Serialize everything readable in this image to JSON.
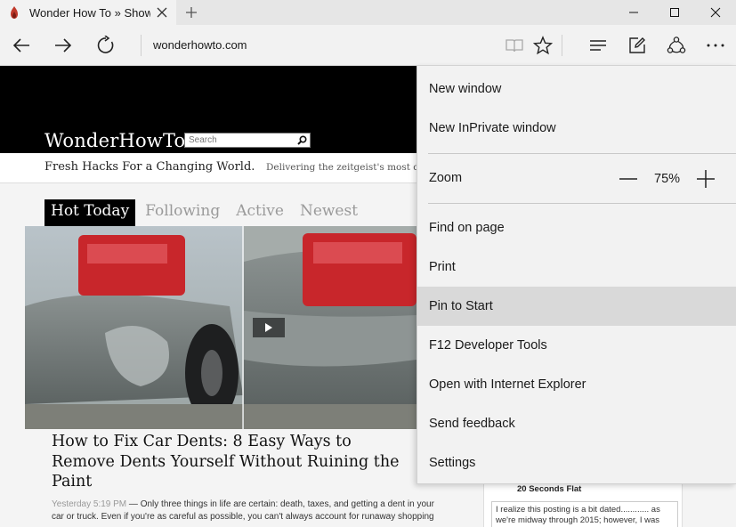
{
  "browser": {
    "tab": {
      "title": "Wonder How To » Show"
    },
    "address": "wonderhowto.com"
  },
  "site": {
    "logo": "WonderHowTo",
    "search_placeholder": "Search",
    "tagline": "Fresh Hacks For a Changing World.",
    "subtagline": "Delivering the zeitgeist's most de",
    "nav": [
      "Hot Today",
      "Following",
      "Active",
      "Newest"
    ],
    "article": {
      "title": "How to Fix Car Dents: 8 Easy Ways to Remove Dents Yourself Without Ruining the Paint",
      "time": "Yesterday 5:19 PM",
      "excerpt": "— Only three things in life are certain: death, taxes, and getting a dent in your car or truck. Even if you're as careful as possible, you can't always account for runaway shopping"
    },
    "side_card": {
      "title": "20 Seconds Flat",
      "text": "I realize this posting is a bit dated............ as we're midway through 2015; however, I was"
    }
  },
  "menu": {
    "items": [
      "New window",
      "New InPrivate window",
      "Find on page",
      "Print",
      "Pin to Start",
      "F12 Developer Tools",
      "Open with Internet Explorer",
      "Send feedback",
      "Settings"
    ],
    "zoom_label": "Zoom",
    "zoom_value": "75%"
  },
  "colors": {
    "chrome": "#f2f2f2",
    "menu_hover": "#d9d9d9",
    "site_header": "#000000"
  }
}
